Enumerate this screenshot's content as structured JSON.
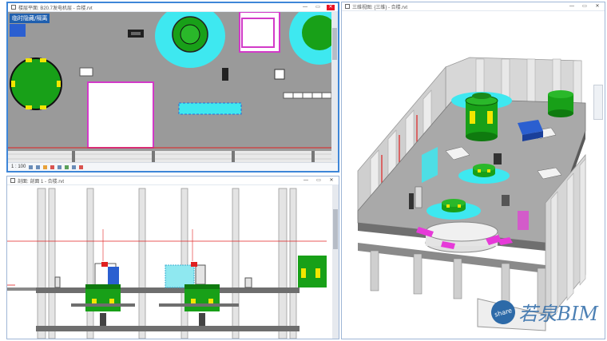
{
  "windows": {
    "plan": {
      "title": "楼层平面: B20.7发电机层 - 合楼.rvt",
      "tag": "临时隐藏/隔离",
      "scale": "1 : 100"
    },
    "section": {
      "title": "剖面: 剖面 1 - 合楼.rvt"
    },
    "threed": {
      "title": "三维视图: {三维} - 合楼.rvt"
    }
  },
  "window_controls": {
    "minimize": "—",
    "restore": "▭",
    "close": "✕"
  },
  "watermark": {
    "badge": "share",
    "text": "若泉BIM"
  },
  "colors": {
    "equipment_green": "#1e9a1e",
    "equipment_yellow": "#f2e600",
    "cyan": "#3ee8f0",
    "magenta": "#e63ad8",
    "slab_grey": "#9a9a9a",
    "grid_red": "#e02020",
    "active_border": "#3e86d8"
  }
}
